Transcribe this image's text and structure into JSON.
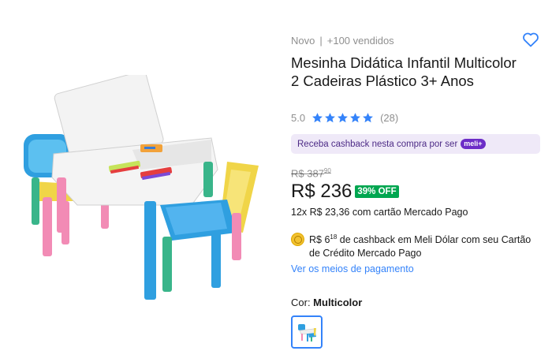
{
  "product": {
    "condition": "Novo",
    "separator": "|",
    "sold": "+100 vendidos",
    "title": "Mesinha Didática Infantil Multicolor 2 Cadeiras Plástico 3+ Anos",
    "rating": "5.0",
    "stars": 5,
    "reviews": "(28)",
    "image_icon": "kids-table-chairs-image"
  },
  "cashback_banner": {
    "text": "Receba cashback nesta compra por ser",
    "badge": "meli+"
  },
  "pricing": {
    "old_currency": "R$ 387",
    "old_cents": "90",
    "price": "R$ 236",
    "discount": "39% OFF",
    "installments": "12x R$ 23,36 com cartão Mercado Pago"
  },
  "meli_dolar": {
    "prefix": "R$ 6",
    "cents": "18",
    "text": " de cashback em Meli Dólar com seu Cartão de Crédito Mercado Pago"
  },
  "payment_link": "Ver os meios de pagamento",
  "color": {
    "label": "Cor: ",
    "value": "Multicolor"
  },
  "colors": {
    "accent": "#3483fa",
    "discount_green": "#00a650",
    "star_blue": "#3483fa",
    "meli_purple": "#6c2dc7"
  }
}
